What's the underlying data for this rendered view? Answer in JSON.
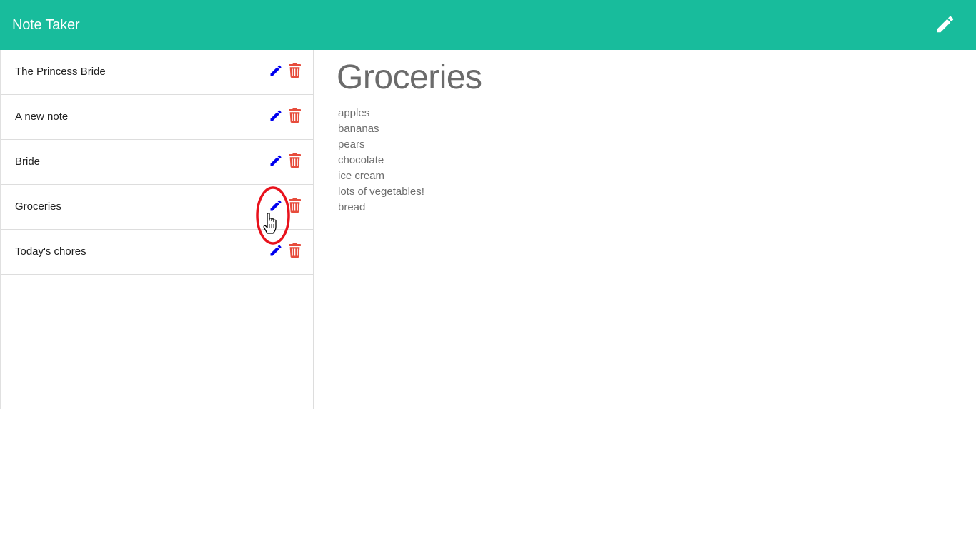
{
  "app": {
    "title": "Note Taker",
    "accent_color": "#18bc9c",
    "new_note_icon": "pencil-icon"
  },
  "sidebar": {
    "edit_icon": "pencil-icon",
    "edit_icon_color": "#0000ee",
    "delete_icon": "trash-icon",
    "delete_icon_color": "#e74c3c",
    "notes": [
      {
        "title": "The Princess Bride"
      },
      {
        "title": "A new note"
      },
      {
        "title": "Bride"
      },
      {
        "title": "Groceries"
      },
      {
        "title": "Today's chores"
      }
    ]
  },
  "active_note": {
    "title": "Groceries",
    "lines": [
      "apples",
      "bananas",
      "pears",
      "chocolate",
      "ice cream",
      "lots of vegetables!",
      "bread"
    ]
  },
  "annotation": {
    "highlight_color": "#e8121c",
    "cursor_icon": "hand-pointer-icon"
  }
}
